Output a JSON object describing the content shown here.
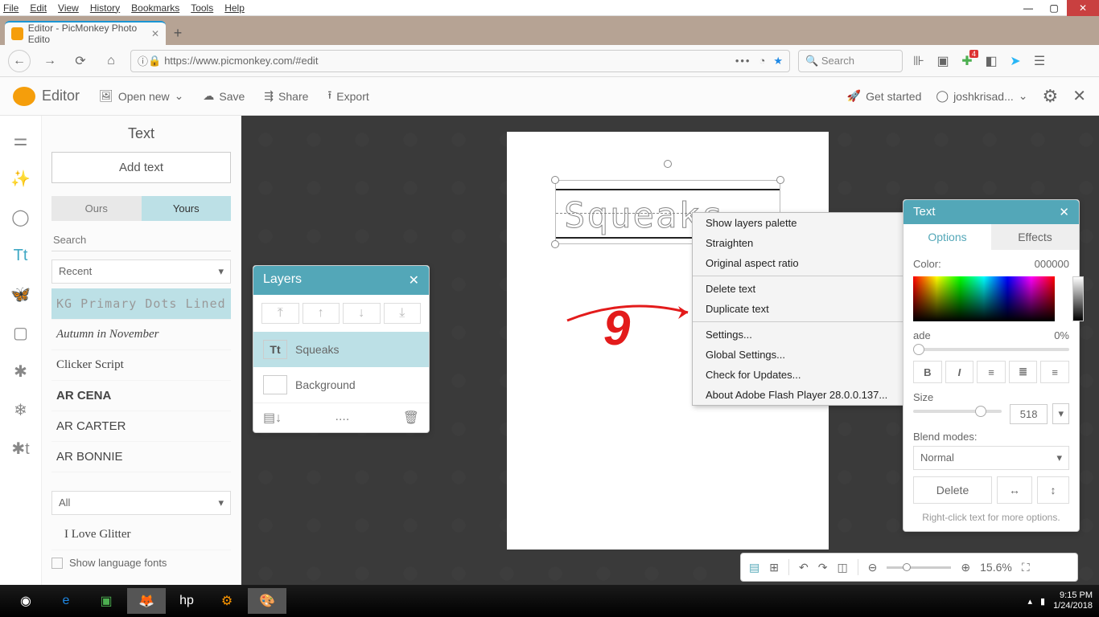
{
  "menubar": [
    "File",
    "Edit",
    "View",
    "History",
    "Bookmarks",
    "Tools",
    "Help"
  ],
  "tab": {
    "title": "Editor - PicMonkey Photo Edito"
  },
  "url": "https://www.picmonkey.com/#edit",
  "search_placeholder": "Search",
  "notif_badge": "4",
  "app": {
    "brand": "Editor",
    "open_new": "Open new",
    "save": "Save",
    "share": "Share",
    "export": "Export",
    "get_started": "Get started",
    "user": "joshkrisad..."
  },
  "sidepanel": {
    "title": "Text",
    "add_text": "Add text",
    "tab_ours": "Ours",
    "tab_yours": "Yours",
    "search": "Search",
    "recent": "Recent",
    "all": "All",
    "show_lang": "Show language fonts",
    "fonts": [
      "KG Primary Dots Lined",
      "Autumn in November",
      "Clicker Script",
      "AR CENA",
      "AR CARTER",
      "AR BONNIE"
    ],
    "font_ilove": "I Love Glitter"
  },
  "layers": {
    "title": "Layers",
    "item1": "Squeaks",
    "item2": "Background"
  },
  "ctx": {
    "show_layers": "Show layers palette",
    "straighten": "Straighten",
    "orig_aspect": "Original aspect ratio",
    "delete_text": "Delete text",
    "duplicate_text": "Duplicate text",
    "settings": "Settings...",
    "global": "Global Settings...",
    "check": "Check for Updates...",
    "about": "About Adobe Flash Player 28.0.0.137..."
  },
  "textpanel": {
    "title": "Text",
    "tab_options": "Options",
    "tab_effects": "Effects",
    "color": "Color:",
    "color_val": "000000",
    "fade": "ade",
    "fade_val": "0%",
    "size": "Size",
    "size_val": "518",
    "blend": "Blend modes:",
    "blend_val": "Normal",
    "delete": "Delete",
    "hint": "Right-click text for more options."
  },
  "canvas_text": "Squeaks",
  "canvasbar": {
    "zoom": "15.6%"
  },
  "clock": {
    "time": "9:15 PM",
    "date": "1/24/2018"
  }
}
